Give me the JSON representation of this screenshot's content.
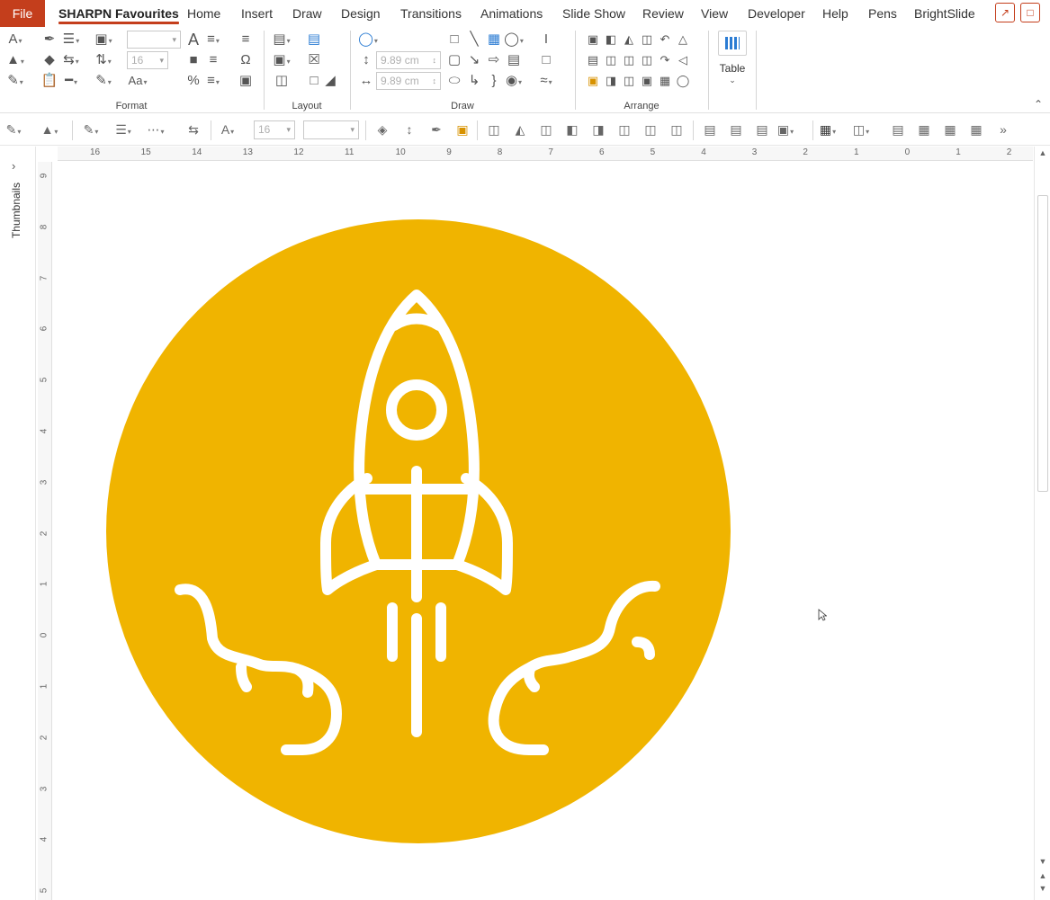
{
  "tabs": {
    "file": "File",
    "items": [
      "SHARPN Favourites",
      "Home",
      "Insert",
      "Draw",
      "Design",
      "Transitions",
      "Animations",
      "Slide Show",
      "Review",
      "View",
      "Developer",
      "Help",
      "Pens",
      "BrightSlide"
    ],
    "active": "SHARPN Favourites"
  },
  "ribbon": {
    "groups": {
      "format": "Format",
      "layout": "Layout",
      "draw": "Draw",
      "arrange": "Arrange"
    },
    "font_size": "16",
    "shape_height": "9.89 cm",
    "shape_width": "9.89 cm",
    "table_label": "Table"
  },
  "toolbar2": {
    "font_size": "16"
  },
  "thumbnails": {
    "label": "Thumbnails"
  },
  "ruler": {
    "horizontal": [
      "16",
      "15",
      "14",
      "13",
      "12",
      "11",
      "10",
      "9",
      "8",
      "7",
      "6",
      "5",
      "4",
      "3",
      "2",
      "1",
      "0",
      "1",
      "2"
    ],
    "vertical": [
      "9",
      "8",
      "7",
      "6",
      "5",
      "4",
      "3",
      "2",
      "1",
      "0",
      "1",
      "2",
      "3",
      "4",
      "5"
    ]
  },
  "slide": {
    "circle_color": "#f0b400",
    "icon": "rocket-launch-icon",
    "icon_color": "#ffffff"
  },
  "colors": {
    "accent": "#c43e1c"
  }
}
